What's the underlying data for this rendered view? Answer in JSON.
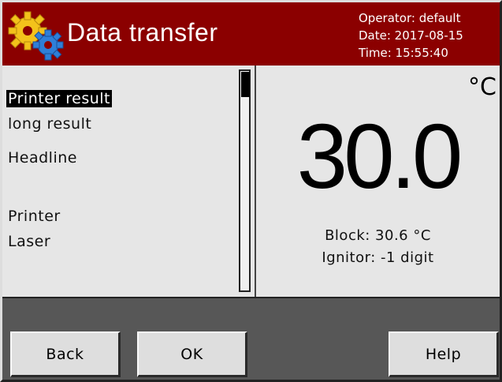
{
  "header": {
    "title": "Data transfer",
    "operator": "Operator: default",
    "date": "Date: 2017-08-15",
    "time": "Time: 15:55:40",
    "logo_icon": "gears-icon"
  },
  "list": {
    "items": [
      {
        "label": "Printer result",
        "selected": true
      },
      {
        "label": "long result",
        "selected": false
      },
      {
        "label": "Headline",
        "selected": false
      },
      {
        "label": "Printer",
        "selected": false
      },
      {
        "label": "Laser",
        "selected": false
      }
    ]
  },
  "measurement": {
    "unit": "°C",
    "value": "30.0",
    "block": "Block: 30.6 °C",
    "ignitor": "Ignitor: -1 digit"
  },
  "buttons": {
    "back": "Back",
    "ok": "OK",
    "help": "Help"
  },
  "colors": {
    "header_bg": "#8b0000",
    "panel_bg": "#e6e6e6",
    "footer_bg": "#575757"
  }
}
